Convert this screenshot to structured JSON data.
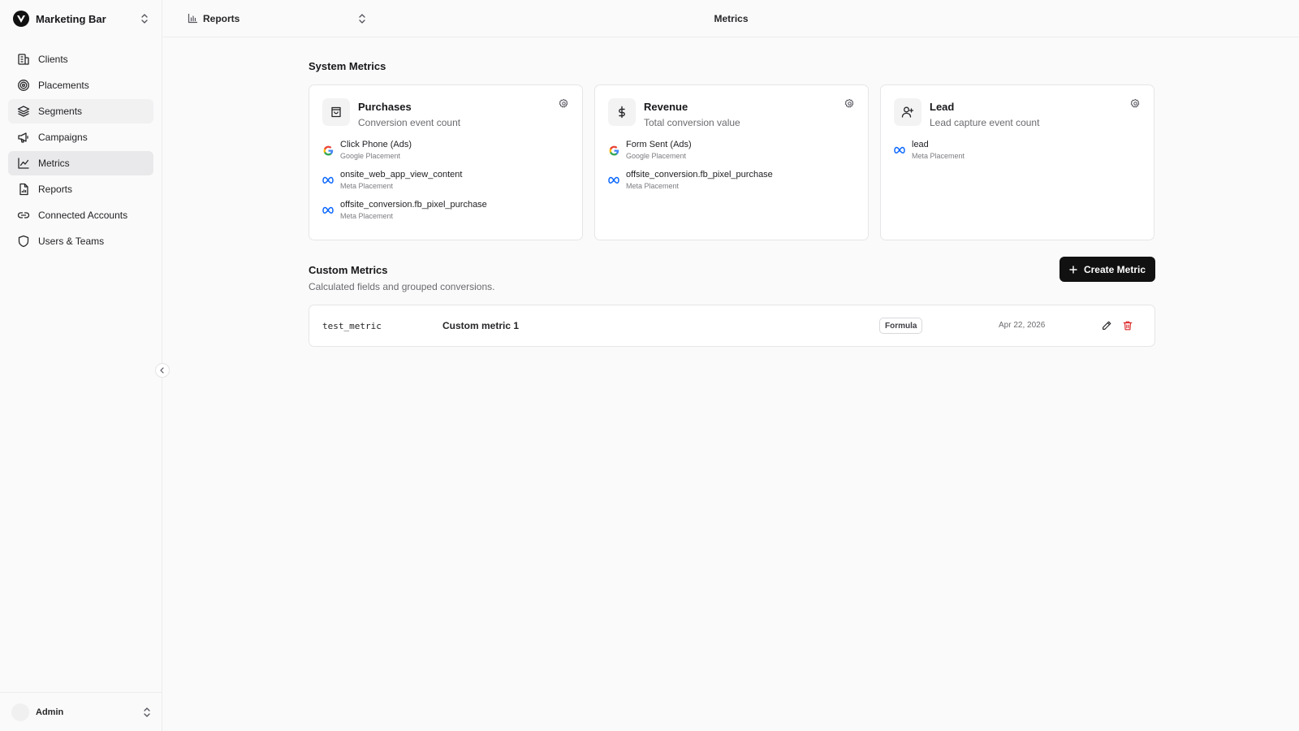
{
  "workspace": {
    "name": "Marketing Bar"
  },
  "sidebar": {
    "items": [
      {
        "label": "Clients",
        "icon": "building-icon"
      },
      {
        "label": "Placements",
        "icon": "target-icon"
      },
      {
        "label": "Segments",
        "icon": "layers-icon"
      },
      {
        "label": "Campaigns",
        "icon": "megaphone-icon"
      },
      {
        "label": "Metrics",
        "icon": "line-chart-icon",
        "active": true
      },
      {
        "label": "Reports",
        "icon": "report-icon"
      },
      {
        "label": "Connected Accounts",
        "icon": "link-icon"
      },
      {
        "label": "Users & Teams",
        "icon": "shield-icon"
      }
    ]
  },
  "user": {
    "name": "Admin"
  },
  "topbar": {
    "report_label": "Reports",
    "page_title": "Metrics"
  },
  "system_metrics": {
    "title": "System Metrics",
    "cards": [
      {
        "title": "Purchases",
        "subtitle": "Conversion event count",
        "icon": "shopping-bag-icon",
        "sources": [
          {
            "name": "Click Phone (Ads)",
            "type": "Google Placement",
            "platform": "google"
          },
          {
            "name": "onsite_web_app_view_content",
            "type": "Meta Placement",
            "platform": "meta"
          },
          {
            "name": "offsite_conversion.fb_pixel_purchase",
            "type": "Meta Placement",
            "platform": "meta"
          }
        ]
      },
      {
        "title": "Revenue",
        "subtitle": "Total conversion value",
        "icon": "dollar-icon",
        "sources": [
          {
            "name": "Form Sent (Ads)",
            "type": "Google Placement",
            "platform": "google"
          },
          {
            "name": "offsite_conversion.fb_pixel_purchase",
            "type": "Meta Placement",
            "platform": "meta"
          }
        ]
      },
      {
        "title": "Lead",
        "subtitle": "Lead capture event count",
        "icon": "user-plus-icon",
        "sources": [
          {
            "name": "lead",
            "type": "Meta Placement",
            "platform": "meta"
          }
        ]
      }
    ]
  },
  "custom_metrics": {
    "title": "Custom Metrics",
    "subtitle": "Calculated fields and grouped conversions.",
    "create_label": "Create Metric",
    "rows": [
      {
        "key": "test_metric",
        "name": "Custom metric 1",
        "badge": "Formula",
        "date": "Apr 22, 2026"
      }
    ]
  },
  "colors": {
    "accent": "#111111",
    "delete": "#dc2626",
    "meta": "#0866ff"
  }
}
